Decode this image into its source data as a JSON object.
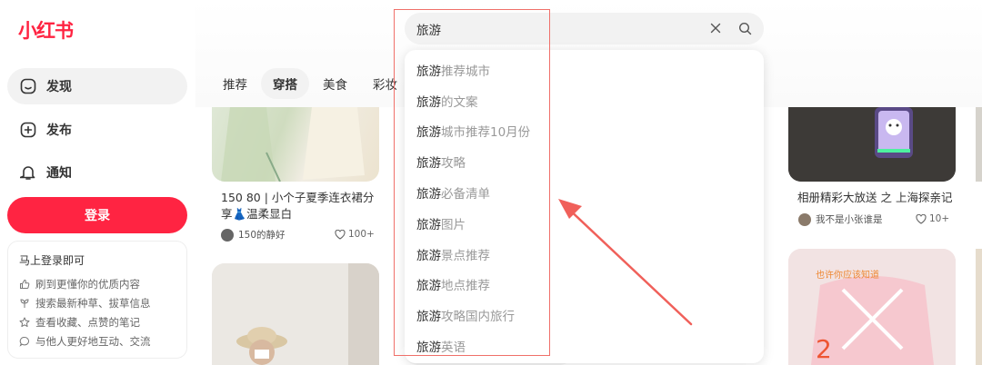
{
  "app": {
    "logo": "小红书",
    "brand_color": "#ff2442"
  },
  "sidebar": {
    "items": [
      {
        "label": "发现",
        "icon": "discover-icon",
        "active": true
      },
      {
        "label": "发布",
        "icon": "plus-square-icon"
      },
      {
        "label": "通知",
        "icon": "bell-icon"
      }
    ],
    "login_button": "登录",
    "login_card": {
      "title": "马上登录即可",
      "features": [
        "刷到更懂你的优质内容",
        "搜索最新种草、拔草信息",
        "查看收藏、点赞的笔记",
        "与他人更好地互动、交流"
      ]
    }
  },
  "channels": [
    "推荐",
    "穿搭",
    "美食",
    "彩妆"
  ],
  "active_channel": "穿搭",
  "search": {
    "value": "旅游"
  },
  "suggestions": [
    {
      "kw": "旅游",
      "rest": "推荐城市"
    },
    {
      "kw": "旅游",
      "rest": "的文案"
    },
    {
      "kw": "旅游",
      "rest": "城市推荐10月份"
    },
    {
      "kw": "旅游",
      "rest": "攻略"
    },
    {
      "kw": "旅游",
      "rest": "必备清单"
    },
    {
      "kw": "旅游",
      "rest": "图片"
    },
    {
      "kw": "旅游",
      "rest": "景点推荐"
    },
    {
      "kw": "旅游",
      "rest": "地点推荐"
    },
    {
      "kw": "旅游",
      "rest": "攻略国内旅行"
    },
    {
      "kw": "旅游",
      "rest": "英语"
    }
  ],
  "notes": [
    {
      "title_line1": "150 80 | 小个子夏季连衣裙分",
      "title_line2": "享👗温柔显白",
      "author": "150的静好",
      "likes": "100+"
    },
    {
      "title_line1": "相册精彩大放送 之 上海探亲记",
      "author": "我不是小张谁是",
      "likes": "10+"
    }
  ],
  "right_photo_text": "也许你应该知道"
}
